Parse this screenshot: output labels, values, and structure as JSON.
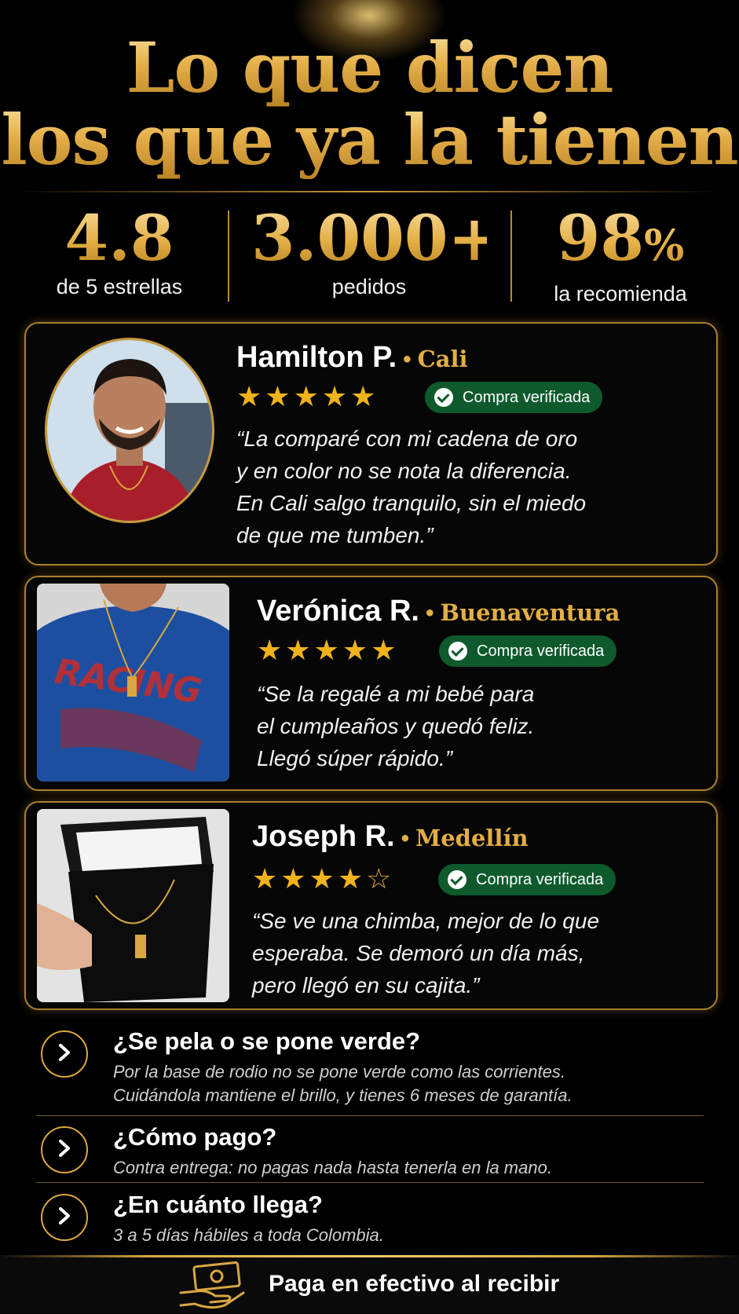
{
  "header": {
    "title_line1": "Lo que dicen",
    "title_line2": "los que ya la tienen"
  },
  "stats": [
    {
      "value": "4.8",
      "suffix": "",
      "label": "de 5 estrellas"
    },
    {
      "value": "3.000+",
      "suffix": "",
      "label": "pedidos"
    },
    {
      "value": "98",
      "suffix": "%",
      "label": "la recomienda"
    }
  ],
  "reviews": [
    {
      "name": "Hamilton P.",
      "city": "Cali",
      "rating": 5,
      "badge": "Compra verificada",
      "quote_lines": [
        "“La comparé con mi cadena de oro",
        "y en color no se nota la diferencia.",
        "En Cali salgo tranquilo, sin el miedo",
        "de que me tumben.”"
      ]
    },
    {
      "name": "Verónica R.",
      "city": "Buenaventura",
      "rating": 5,
      "badge": "Compra verificada",
      "quote_lines": [
        "“Se la regalé a mi bebé para",
        "el cumpleaños y quedó feliz.",
        "Llegó súper rápido.”"
      ]
    },
    {
      "name": "Joseph R.",
      "city": "Medellín",
      "rating": 4,
      "badge": "Compra verificada",
      "quote_lines": [
        "“Se ve una chimba, mejor de lo que",
        "esperaba. Se demoró un día más,",
        "pero llegó en su cajita.”"
      ]
    }
  ],
  "faq": [
    {
      "question": "¿Se pela o se pone verde?",
      "answer_lines": [
        "Por la base de rodio no se pone verde como las corrientes.",
        "Cuidándola mantiene el brillo, y tienes 6 meses de garantía."
      ]
    },
    {
      "question": "¿Cómo pago?",
      "answer_lines": [
        "Contra entrega: no pagas nada hasta tenerla en la mano."
      ]
    },
    {
      "question": "¿En cuánto llega?",
      "answer_lines": [
        "3 a 5 días hábiles a toda Colombia."
      ]
    }
  ],
  "footer": {
    "text": "Paga en efectivo al recibir",
    "icon": "cash-in-hand-icon"
  },
  "colors": {
    "gold": "#e3ae45",
    "badge_green": "#0e5a2c",
    "background": "#000000"
  }
}
